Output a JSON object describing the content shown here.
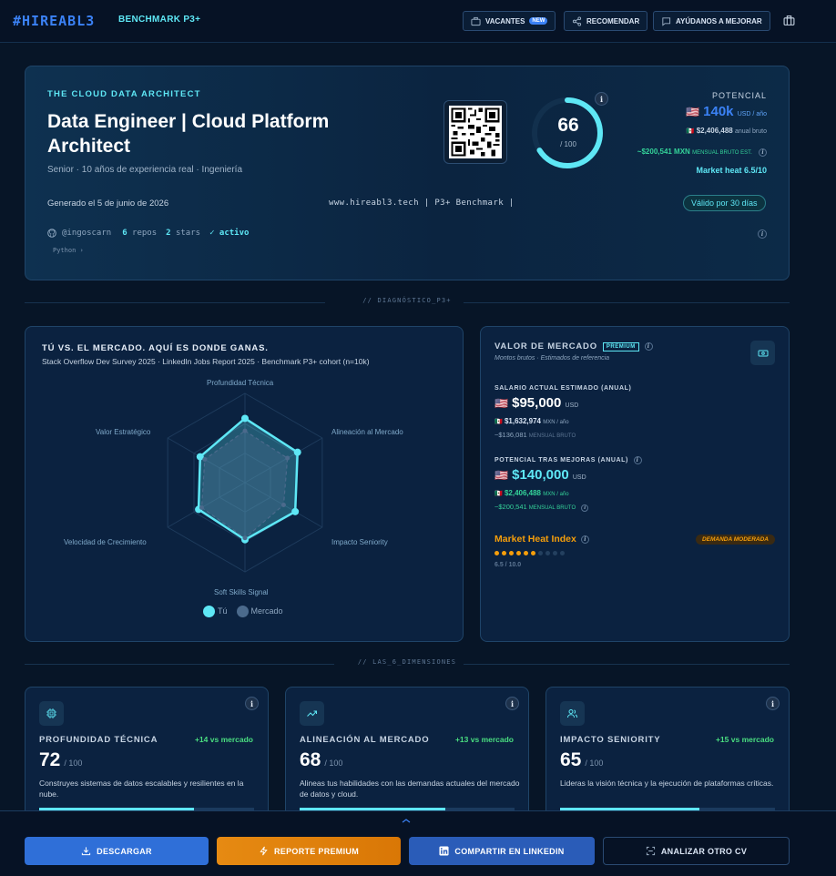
{
  "header": {
    "logo": "#HIREABL3",
    "badge": "BENCHMARK P3+",
    "vacantes": "VACANTES",
    "new_badge": "NEW",
    "recomendar": "RECOMENDAR",
    "mejorar": "AYÚDANOS A MEJORAR"
  },
  "hero": {
    "kicker": "THE CLOUD DATA ARCHITECT",
    "title": "Data Engineer | Cloud Platform Architect",
    "subtitle": "Senior · 10 años de experiencia real · Ingeniería",
    "generated": "Generado el 5 de junio de 2026",
    "site": "www.hireabl3.tech | P3+ Benchmark |",
    "valid": "Válido por 30 días",
    "github_user": "@ingoscarn",
    "repos_count": "6",
    "repos_label": "repos",
    "stars_count": "2",
    "stars_label": "stars",
    "status": "✓ activo",
    "language": "Python ›",
    "score": "66",
    "score_max": "/ 100",
    "score_value": 66,
    "potential_label": "POTENCIAL",
    "potential_value": "140k",
    "potential_unit": "USD / año",
    "annual_mxn": "$2,406,488",
    "annual_mxn_label": "anual bruto",
    "monthly_mxn": "~$200,541 MXN",
    "monthly_label": "MENSUAL BRUTO EST.",
    "market_heat": "Market heat 6.5/10"
  },
  "sep1": "// DIAGNÓSTICO_P3+",
  "sep2": "// LAS_6_DIMENSIONES",
  "radar": {
    "title": "TÚ VS. EL MERCADO. AQUÍ ES DONDE GANAS.",
    "subtitle": "Stack Overflow Dev Survey 2025 · LinkedIn Jobs Report 2025 · Benchmark P3+ cohort (n=10k)",
    "axes": [
      "Profundidad Técnica",
      "Alineación al Mercado",
      "Impacto Seniority",
      "Soft Skills Signal",
      "Velocidad de Crecimiento",
      "Valor Estratégico"
    ],
    "you": [
      72,
      68,
      65,
      64,
      60,
      58
    ],
    "market": [
      58,
      55,
      50,
      62,
      56,
      52
    ],
    "legend_you": "Tú",
    "legend_market": "Mercado",
    "colors": {
      "you": "#5ee7f5",
      "market": "#4b6a8c"
    }
  },
  "market_value": {
    "title": "VALOR DE MERCADO",
    "premium": "PREMIUM",
    "subtitle": "Montos brutos · Estimados de referencia",
    "current_label": "SALARIO ACTUAL ESTIMADO (ANUAL)",
    "current_usd": "$95,000",
    "current_unit": "USD",
    "current_mxn": "$1,632,974",
    "current_mxn_unit": "MXN / año",
    "current_monthly": "~$136,081",
    "current_monthly_label": "MENSUAL BRUTO",
    "potential_label": "POTENCIAL TRAS MEJORAS (ANUAL)",
    "potential_usd": "$140,000",
    "potential_unit": "USD",
    "potential_mxn": "$2,406,488",
    "potential_mxn_unit": "MXN / año",
    "potential_monthly": "~$200,541",
    "potential_monthly_label": "MENSUAL BRUTO",
    "heat_title": "Market Heat Index",
    "heat_badge": "DEMANDA MODERADA",
    "heat_value": 6.5,
    "heat_label": "6.5 / 10.0"
  },
  "dimensions": [
    {
      "name": "PROFUNDIDAD TÉCNICA",
      "delta": "+14 vs mercado",
      "score": "72",
      "max": "/ 100",
      "desc": "Construyes sistemas de datos escalables y resilientes en la nube.",
      "value": 72,
      "icon": "chip-icon"
    },
    {
      "name": "ALINEACIÓN AL MERCADO",
      "delta": "+13 vs mercado",
      "score": "68",
      "max": "/ 100",
      "desc": "Alineas tus habilidades con las demandas actuales del mercado de datos y cloud.",
      "value": 68,
      "icon": "trend-icon"
    },
    {
      "name": "IMPACTO SENIORITY",
      "delta": "+15 vs mercado",
      "score": "65",
      "max": "/ 100",
      "desc": "Lideras la visión técnica y la ejecución de plataformas críticas.",
      "value": 65,
      "icon": "users-icon"
    }
  ],
  "actions": {
    "download": "DESCARGAR",
    "premium": "REPORTE PREMIUM",
    "linkedin": "COMPARTIR EN LINKEDIN",
    "analyze": "ANALIZAR OTRO CV"
  }
}
